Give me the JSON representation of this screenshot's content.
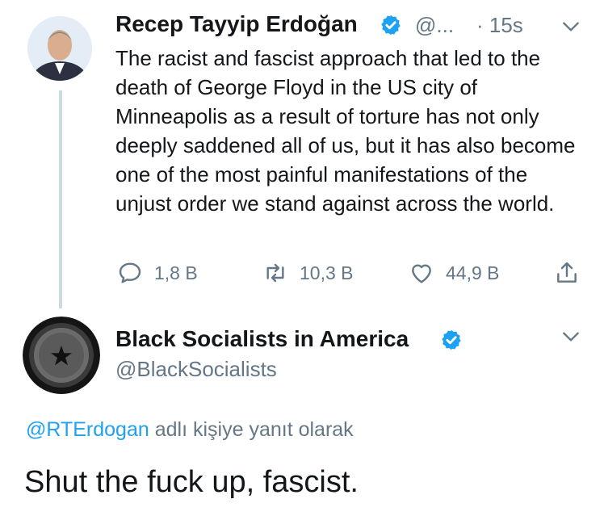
{
  "tweet1": {
    "display_name": "Recep Tayyip Erdoğan",
    "handle": "@...",
    "time": "· 15s",
    "text": "The racist and fascist approach that led to the death of George Floyd in the US city of Minneapolis as a result of torture has not only deeply saddened all of us, but it has also become one of the most painful manifestations of the unjust order we stand against across the world.",
    "actions": {
      "replies": "1,8 B",
      "retweets": "10,3 B",
      "likes": "44,9 B"
    }
  },
  "tweet2": {
    "display_name": "Black Socialists in America",
    "handle": "@BlackSocialists",
    "reply_to_handle": "@RTErdogan",
    "reply_to_suffix": "adlı kişiye yanıt olarak",
    "text": "Shut the fuck up, fascist."
  },
  "colors": {
    "accent": "#1da1f2",
    "muted": "#657786",
    "text": "#14171a",
    "thread_line": "#cfd9de"
  },
  "icons": [
    "verified-badge-icon",
    "chevron-down-icon",
    "reply-icon",
    "retweet-icon",
    "like-icon",
    "share-icon"
  ]
}
